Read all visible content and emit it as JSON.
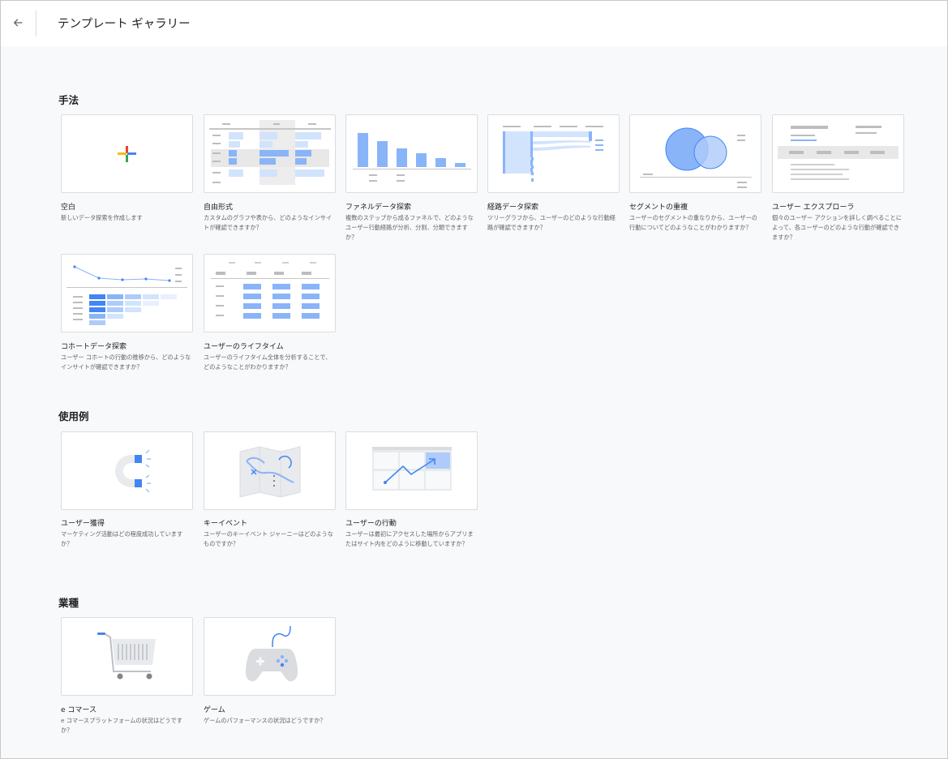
{
  "header": {
    "title": "テンプレート ギャラリー",
    "back_icon": "arrow-back-icon"
  },
  "sections": {
    "techniques": {
      "title": "手法",
      "cards": [
        {
          "name": "空白",
          "desc": "新しいデータ探索を作成します",
          "icon": "plus-icon"
        },
        {
          "name": "自由形式",
          "desc": "カスタムのグラフや表から、どのようなインサイトが確認できますか？",
          "icon": "free-form-icon"
        },
        {
          "name": "ファネルデータ探索",
          "desc": "複数のステップから成るファネルで、どのようなユーザー行動経路が分析、分割、分類できますか？",
          "icon": "funnel-icon"
        },
        {
          "name": "経路データ探索",
          "desc": "ツリーグラフから、ユーザーのどのような行動経路が確認できますか？",
          "icon": "path-icon"
        },
        {
          "name": "セグメントの重複",
          "desc": "ユーザーのセグメントの重なりから、ユーザーの行動についてどのようなことがわかりますか？",
          "icon": "venn-icon"
        },
        {
          "name": "ユーザー エクスプローラ",
          "desc": "個々のユーザー アクションを詳しく調べることによって、各ユーザーのどのような行動が確認できますか？",
          "icon": "user-explorer-icon"
        },
        {
          "name": "コホートデータ探索",
          "desc": "ユーザー コホートの行動の推移から、どのようなインサイトが確認できますか？",
          "icon": "cohort-icon"
        },
        {
          "name": "ユーザーのライフタイム",
          "desc": "ユーザーのライフタイム全体を分析することで、どのようなことがわかりますか？",
          "icon": "lifetime-icon"
        }
      ]
    },
    "use_cases": {
      "title": "使用例",
      "cards": [
        {
          "name": "ユーザー獲得",
          "desc": "マーケティング活動はどの程度成功していますか？",
          "icon": "magnet-icon"
        },
        {
          "name": "キーイベント",
          "desc": "ユーザーのキーイベント ジャーニーはどのようなものですか？",
          "icon": "map-icon"
        },
        {
          "name": "ユーザーの行動",
          "desc": "ユーザーは最初にアクセスした場所からアプリまたはサイト内をどのように移動していますか？",
          "icon": "trend-arrow-icon"
        }
      ]
    },
    "industries": {
      "title": "業種",
      "cards": [
        {
          "name": "e コマース",
          "desc": "e コマースプラットフォームの状況はどうですか？",
          "icon": "shopping-cart-icon"
        },
        {
          "name": "ゲーム",
          "desc": "ゲームのパフォーマンスの状況はどうですか？",
          "icon": "gamepad-icon"
        }
      ]
    }
  },
  "colors": {
    "accent_blue": "#8ab4f8",
    "dark_blue": "#4285f4",
    "light_blue": "#d2e3fc",
    "gray": "#dadce0",
    "background": "#f8f9fa"
  }
}
